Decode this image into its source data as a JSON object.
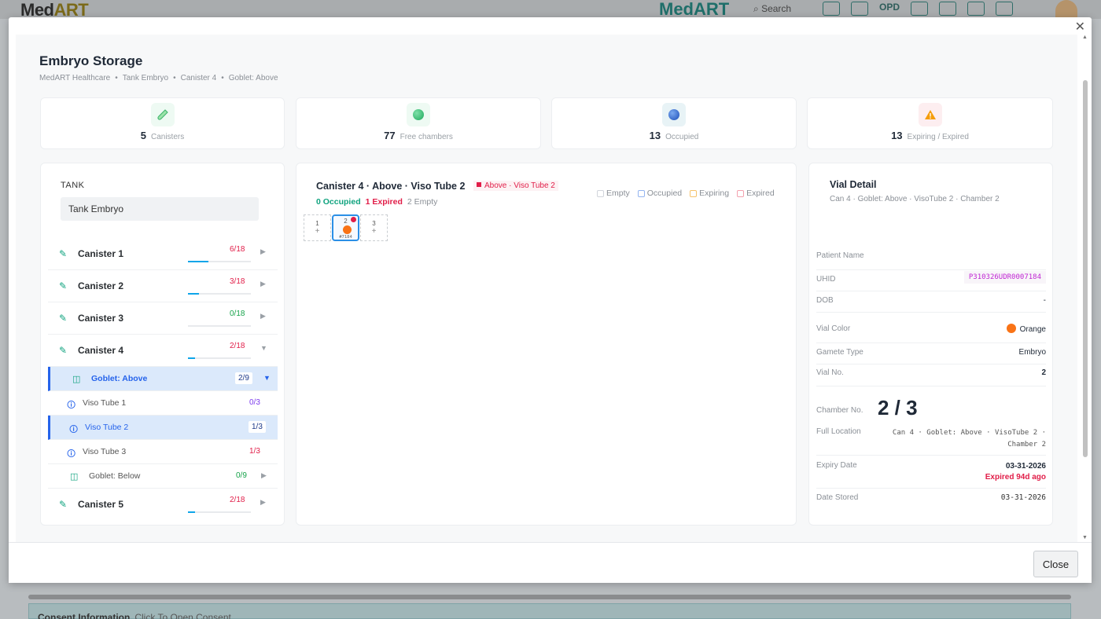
{
  "background": {
    "logo_prefix": "Med",
    "logo_suffix": "ART",
    "brand": "MedART",
    "search": "Search",
    "opd": "OPD",
    "bottom_title": "Consent Information",
    "bottom_hint": "Click To Open Consent"
  },
  "modal": {
    "title": "Embryo Storage",
    "breadcrumb": [
      "MedART Healthcare",
      "Tank Embryo",
      "Canister 4",
      "Goblet: Above"
    ],
    "close_label": "Close"
  },
  "stats": [
    {
      "value": "5",
      "label": "Canisters",
      "icon": "test-tube-icon"
    },
    {
      "value": "77",
      "label": "Free chambers",
      "icon": "green-dot-icon"
    },
    {
      "value": "13",
      "label": "Occupied",
      "icon": "blue-dot-icon"
    },
    {
      "value": "13",
      "label": "Expiring / Expired",
      "icon": "warning-icon"
    }
  ],
  "tank": {
    "label": "TANK",
    "value": "Tank Embryo",
    "canisters": [
      {
        "name": "Canister 1",
        "count": "6/18",
        "fill": 0.33
      },
      {
        "name": "Canister 2",
        "count": "3/18",
        "fill": 0.17
      },
      {
        "name": "Canister 3",
        "count": "0/18",
        "fill": 0
      },
      {
        "name": "Canister 4",
        "count": "2/18",
        "fill": 0.11
      },
      {
        "name": "Canister 5",
        "count": "2/18",
        "fill": 0.11
      }
    ],
    "goblet_above": {
      "label": "Goblet: Above",
      "count": "2/9"
    },
    "tubes": [
      {
        "label": "Viso Tube 1",
        "count": "0/3"
      },
      {
        "label": "Viso Tube 2",
        "count": "1/3"
      },
      {
        "label": "Viso Tube 3",
        "count": "1/3"
      }
    ],
    "goblet_below": {
      "label": "Goblet: Below",
      "count": "0/9"
    }
  },
  "center": {
    "heading": "Canister 4 · Above · Viso Tube 2",
    "tag": "Above · Viso Tube 2",
    "occupied": "0 Occupied",
    "expired": "1 Expired",
    "empty": "2 Empty",
    "legend": [
      "Empty",
      "Occupied",
      "Expiring",
      "Expired"
    ],
    "legend_colors": [
      "#d1d5db",
      "#93b4f0",
      "#f5c26b",
      "#f3a1ae"
    ],
    "chambers": [
      {
        "num": "1",
        "plus": "+"
      },
      {
        "num": "2",
        "code": "#7184"
      },
      {
        "num": "3",
        "plus": "+"
      }
    ]
  },
  "vial": {
    "title": "Vial Detail",
    "subtitle": "Can 4 · Goblet: Above · VisoTube 2 · Chamber 2",
    "patient_name_label": "Patient Name",
    "uhid_label": "UHID",
    "uhid": "P310326UDR0007184",
    "dob_label": "DOB",
    "dob": "-",
    "color_label": "Vial Color",
    "color": "Orange",
    "gamete_label": "Gamete Type",
    "gamete": "Embryo",
    "vial_no_label": "Vial No.",
    "vial_no": "2",
    "chamber_label": "Chamber No.",
    "chamber": "2 / 3",
    "location_label": "Full Location",
    "location_line1": "Can 4 · Goblet: Above · VisoTube 2 ·",
    "location_line2": "Chamber 2",
    "expiry_label": "Expiry Date",
    "expiry": "03-31-2026",
    "expired_note": "Expired 94d ago",
    "stored_label": "Date Stored",
    "stored": "03-31-2026"
  }
}
